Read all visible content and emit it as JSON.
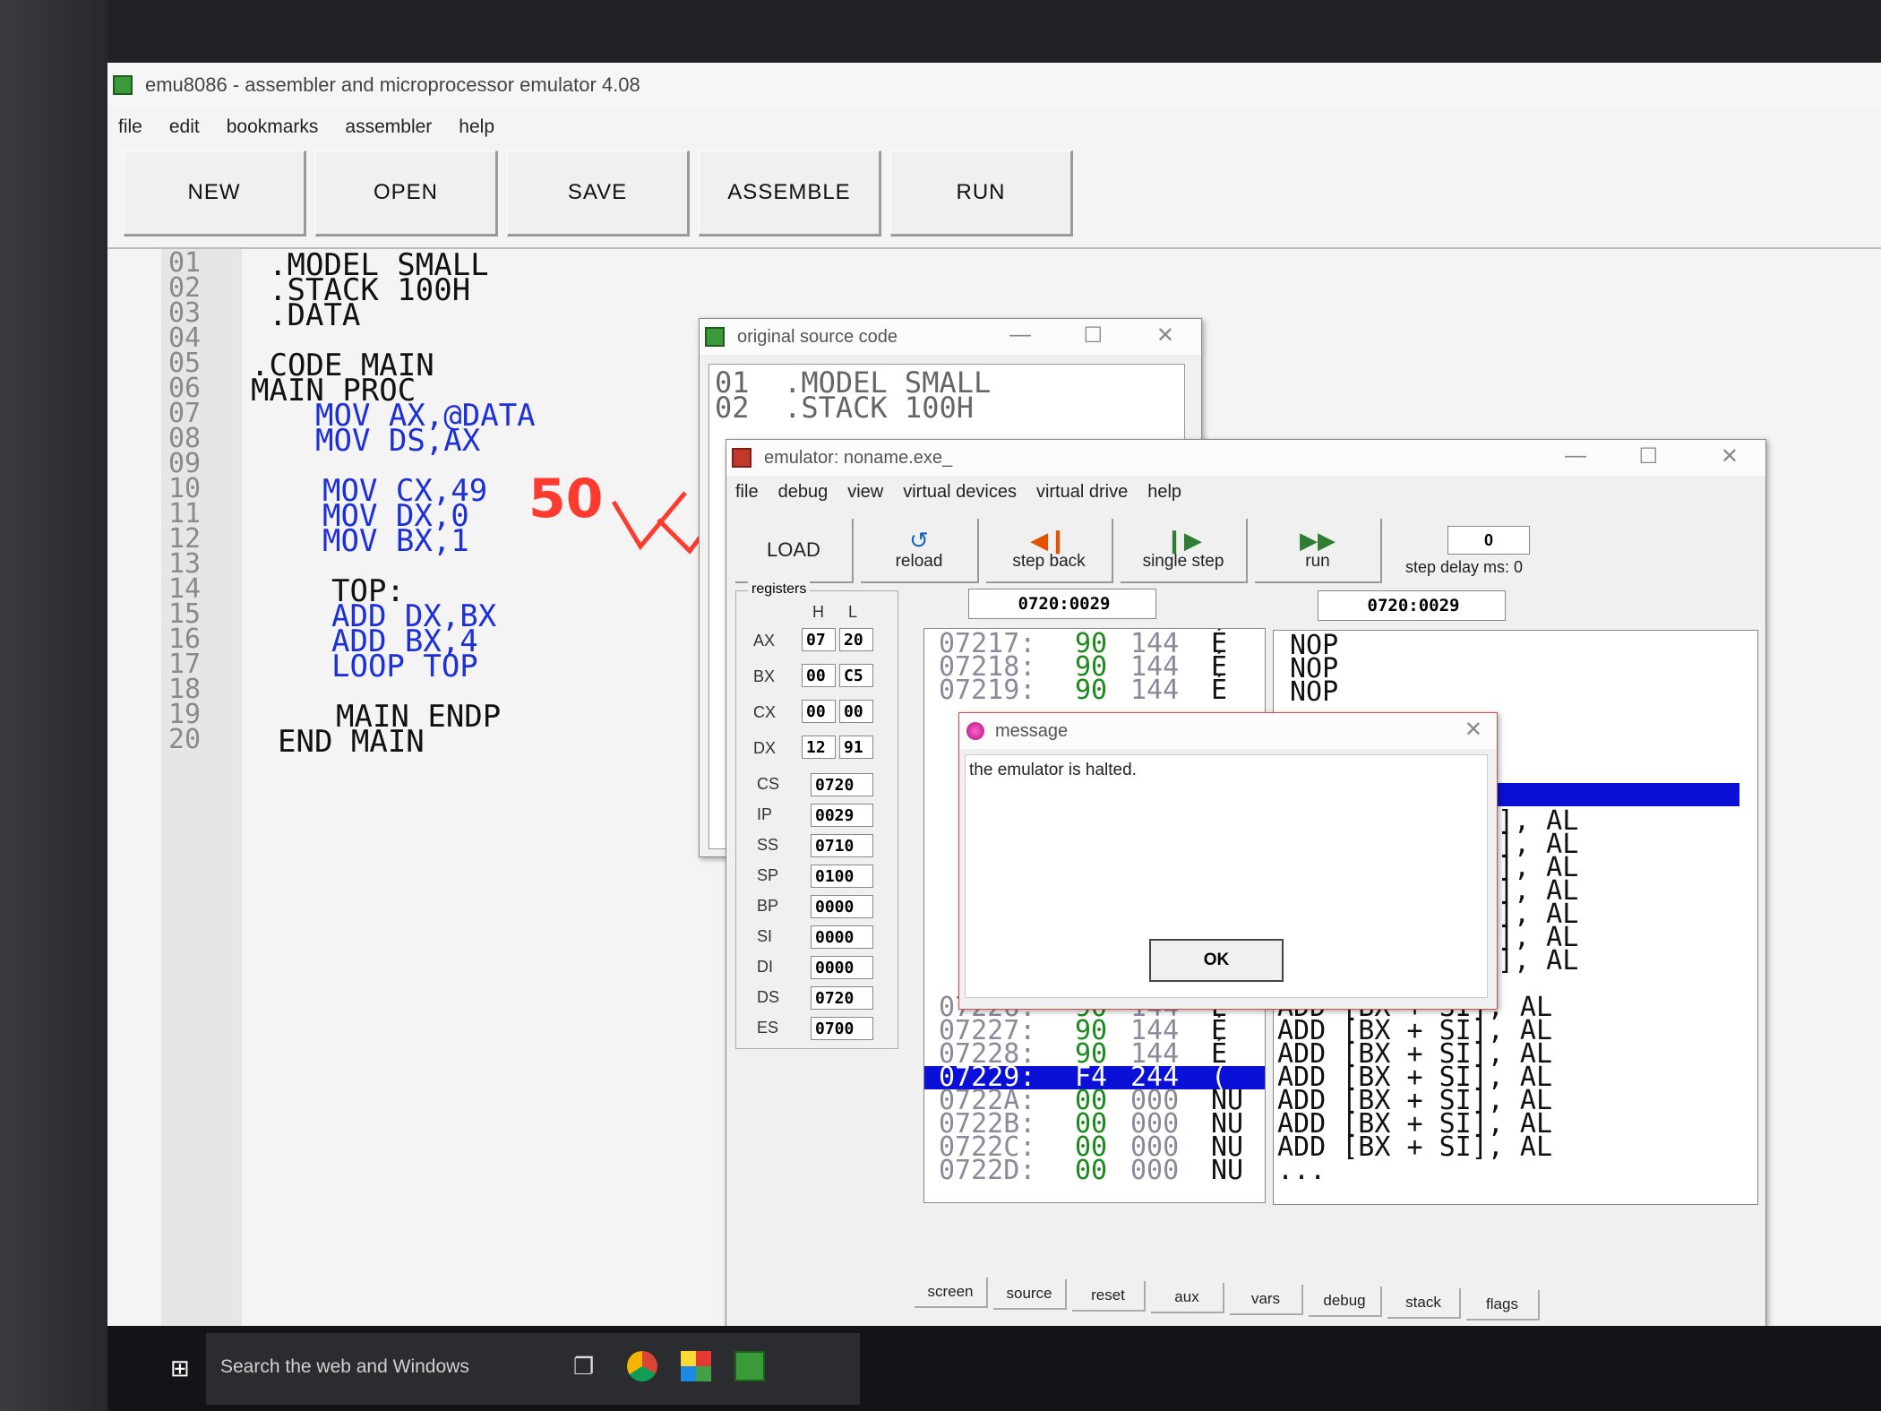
{
  "app": {
    "title": "emu8086 - assembler and microprocessor emulator 4.08"
  },
  "menu": [
    "file",
    "edit",
    "bookmarks",
    "assembler",
    "help"
  ],
  "toolbar": [
    "NEW",
    "OPEN",
    "SAVE",
    "ASSEMBLE",
    "RUN"
  ],
  "editor": {
    "line_numbers": [
      "01",
      "02",
      "03",
      "04",
      "05",
      "06",
      "07",
      "08",
      "09",
      "10",
      "11",
      "12",
      "13",
      "14",
      "15",
      "16",
      "17",
      "18",
      "19",
      "20"
    ],
    "lines": [
      ".MODEL SMALL",
      ".STACK 100H",
      ".DATA",
      "",
      ".CODE MAIN",
      "MAIN PROC",
      "MOV AX,@DATA",
      "MOV DS,AX",
      "",
      "MOV CX,49",
      "MOV DX,0",
      "MOV BX,1",
      "",
      "TOP:",
      "ADD DX,BX",
      "ADD BX,4",
      "LOOP TOP",
      "",
      "MAIN ENDP",
      "END MAIN"
    ],
    "annotation": "50"
  },
  "source_window": {
    "title": "original source code",
    "lines": [
      "01  .MODEL SMALL",
      "02  .STACK 100H"
    ]
  },
  "emulator": {
    "title": "emulator: noname.exe_",
    "menu": [
      "file",
      "debug",
      "view",
      "virtual devices",
      "virtual drive",
      "help"
    ],
    "buttons": {
      "load": "LOAD",
      "reload": "reload",
      "step_back": "step back",
      "single_step": "single step",
      "run": "run"
    },
    "step_delay_label": "step delay ms: 0",
    "step_delay_value": "0",
    "registers_label": "registers",
    "hl_headers": {
      "h": "H",
      "l": "L"
    },
    "regs_hl": [
      {
        "name": "AX",
        "h": "07",
        "l": "20"
      },
      {
        "name": "BX",
        "h": "00",
        "l": "C5"
      },
      {
        "name": "CX",
        "h": "00",
        "l": "00"
      },
      {
        "name": "DX",
        "h": "12",
        "l": "91"
      }
    ],
    "regs": [
      {
        "name": "CS",
        "val": "0720"
      },
      {
        "name": "IP",
        "val": "0029"
      },
      {
        "name": "SS",
        "val": "0710"
      },
      {
        "name": "SP",
        "val": "0100"
      },
      {
        "name": "BP",
        "val": "0000"
      },
      {
        "name": "SI",
        "val": "0000"
      },
      {
        "name": "DI",
        "val": "0000"
      },
      {
        "name": "DS",
        "val": "0720"
      },
      {
        "name": "ES",
        "val": "0700"
      }
    ],
    "addr_left": "0720:0029",
    "addr_right": "0720:0029",
    "memory_top": [
      {
        "addr": "07217:",
        "hex": "90",
        "dec": "144",
        "ch": "É"
      },
      {
        "addr": "07218:",
        "hex": "90",
        "dec": "144",
        "ch": "É"
      },
      {
        "addr": "07219:",
        "hex": "90",
        "dec": "144",
        "ch": "É"
      }
    ],
    "memory_bottom": [
      {
        "addr": "07226:",
        "hex": "90",
        "dec": "144",
        "ch": "É"
      },
      {
        "addr": "07227:",
        "hex": "90",
        "dec": "144",
        "ch": "É"
      },
      {
        "addr": "07228:",
        "hex": "90",
        "dec": "144",
        "ch": "É"
      },
      {
        "addr": "07229:",
        "hex": "F4",
        "dec": "244",
        "ch": "("
      },
      {
        "addr": "0722A:",
        "hex": "00",
        "dec": "000",
        "ch": "NU"
      },
      {
        "addr": "0722B:",
        "hex": "00",
        "dec": "000",
        "ch": "NU"
      },
      {
        "addr": "0722C:",
        "hex": "00",
        "dec": "000",
        "ch": "NU"
      },
      {
        "addr": "0722D:",
        "hex": "00",
        "dec": "000",
        "ch": "NU"
      }
    ],
    "disasm_top": [
      "NOP",
      "NOP",
      "NOP"
    ],
    "disasm_bottom": [
      "ADD [BX + SI], AL",
      "ADD [BX + SI], AL",
      "ADD [BX + SI], AL",
      "ADD [BX + SI], AL",
      "ADD [BX + SI], AL",
      "ADD [BX + SI], AL",
      "ADD [BX + SI], AL",
      "..."
    ],
    "disasm_al_column": [
      "], AL",
      "], AL",
      "], AL",
      "], AL",
      "], AL",
      "], AL",
      "], AL"
    ],
    "tabs": [
      "screen",
      "source",
      "reset",
      "aux",
      "vars",
      "debug",
      "stack",
      "flags"
    ]
  },
  "message": {
    "title": "message",
    "text": "the emulator is halted.",
    "ok": "OK"
  },
  "taskbar": {
    "search_placeholder": "Search the web and Windows"
  },
  "colors": {
    "keyword": "#1c2fd8",
    "register": "#c8262a",
    "highlight": "#0a10d6",
    "memory_value": "#1a8a1a",
    "annotation": "#ff3b30"
  }
}
